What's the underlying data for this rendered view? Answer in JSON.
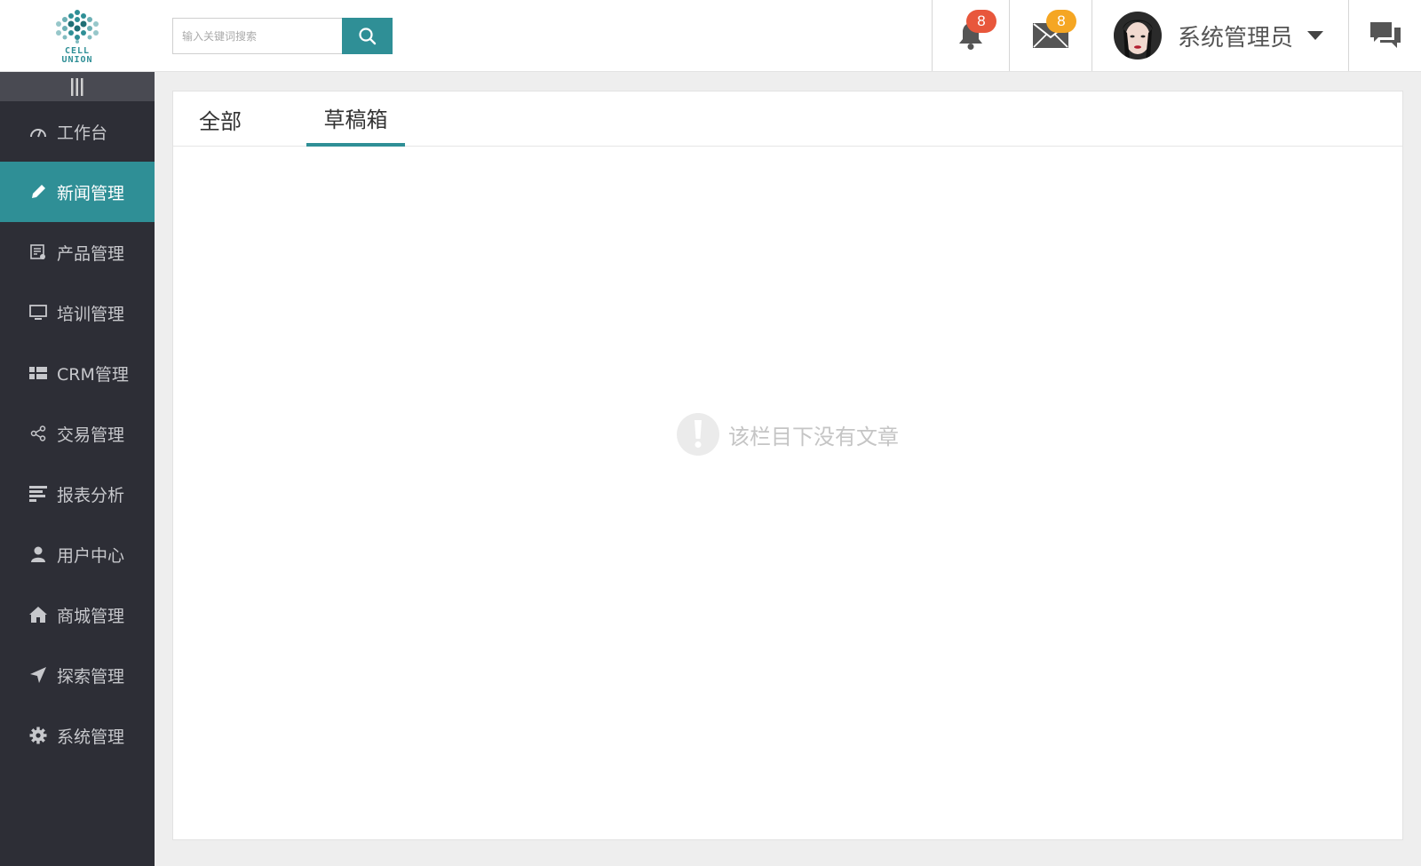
{
  "brand": {
    "logo_text_line1": "CELL",
    "logo_text_line2": "UNION"
  },
  "search": {
    "placeholder": "输入关键词搜索"
  },
  "header": {
    "notifications_count": "8",
    "messages_count": "8",
    "user_name": "系统管理员"
  },
  "colors": {
    "accent": "#2f8f96",
    "sidebar_bg": "#2d2e36",
    "badge_red": "#e8573c",
    "badge_orange": "#f5a623"
  },
  "sidebar": {
    "items": [
      {
        "label": "工作台",
        "icon": "dashboard-icon"
      },
      {
        "label": "新闻管理",
        "icon": "pencil-icon",
        "active": true
      },
      {
        "label": "产品管理",
        "icon": "product-list-icon"
      },
      {
        "label": "培训管理",
        "icon": "monitor-icon"
      },
      {
        "label": "CRM管理",
        "icon": "grid-icon"
      },
      {
        "label": "交易管理",
        "icon": "share-icon"
      },
      {
        "label": "报表分析",
        "icon": "report-icon"
      },
      {
        "label": "用户中心",
        "icon": "user-icon"
      },
      {
        "label": "商城管理",
        "icon": "home-icon"
      },
      {
        "label": "探索管理",
        "icon": "paper-plane-icon"
      },
      {
        "label": "系统管理",
        "icon": "gear-icon"
      }
    ]
  },
  "tabs": [
    {
      "label": "全部"
    },
    {
      "label": "草稿箱",
      "active": true
    }
  ],
  "empty_state": {
    "message": "该栏目下没有文章"
  }
}
